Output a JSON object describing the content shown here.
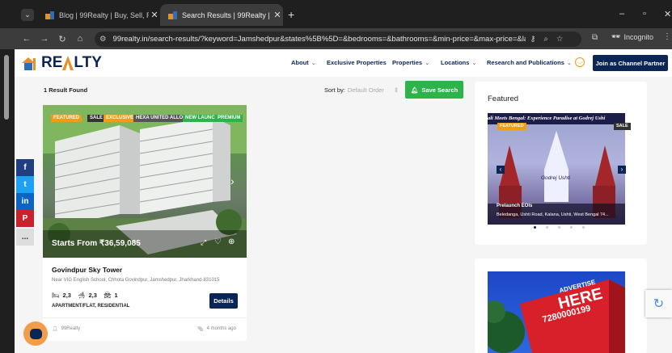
{
  "browser": {
    "tabs": [
      {
        "title": "Blog | 99Realty | Buy, Sell, Rent",
        "active": false
      },
      {
        "title": "Search Results | 99Realty | Buy,",
        "active": true
      }
    ],
    "new_tab": "+",
    "url": "99realty.in/search-results/?keyword=Jamshedpur&states%5B%5D=&bedrooms=&bathrooms=&min-price=&max-price=&la...",
    "incognito_label": "Incognito"
  },
  "site": {
    "logo_text_left": "RE",
    "logo_text_right": "LTY",
    "nav": [
      {
        "label": "About",
        "dropdown": true
      },
      {
        "label": "Exclusive Properties",
        "dropdown": false
      },
      {
        "label": "Properties",
        "dropdown": true
      },
      {
        "label": "Locations",
        "dropdown": true
      },
      {
        "label": "Research and Publications",
        "dropdown": true
      }
    ],
    "cta": "Join as Channel Partner"
  },
  "results": {
    "count_label": "1 Result Found",
    "sort_label": "Sort by:",
    "sort_value": "Default Order",
    "save_search": "Save Search"
  },
  "listing": {
    "tags": [
      "FEATURED",
      "SALE",
      "EXCLUSIVE",
      "HEXA UNITED ALLOYS",
      "NEW LAUNCH",
      "PREMIUM"
    ],
    "price": "Starts From ₹36,59,085",
    "title": "Govindpur Sky Tower",
    "address": "Near VIG English School, Chhota Govindpur, Jamshedpur, Jharkhand-831015",
    "beds": "2,3",
    "baths": "2,3",
    "garage": "1",
    "type": "APARTMENT/FLAT, RESIDENTIAL",
    "details_btn": "Details",
    "author": "99Realty",
    "posted": "4 months ago"
  },
  "featured": {
    "heading": "Featured",
    "slide_title": "ali Meets Bengal: Experience Paradise at Godrej Ushi",
    "badge_featured": "FEATURED",
    "badge_sale": "SALE",
    "brand": "Godrej Ushti",
    "status": "Prelaunch EOIs",
    "address": "Beledanga, Ushti Road, Kalana, Ushti, West Bengal 74...",
    "dots": 5,
    "active_dot": 0
  },
  "ad": {
    "line1": "ADVERTISE",
    "line2": "HERE",
    "phone": "7280000199"
  },
  "social": [
    "f",
    "t",
    "in",
    "P",
    "..."
  ],
  "colors": {
    "navy": "#0b2656",
    "green": "#2cb34a",
    "orange": "#f39c12",
    "ad_red": "#d8202a"
  }
}
